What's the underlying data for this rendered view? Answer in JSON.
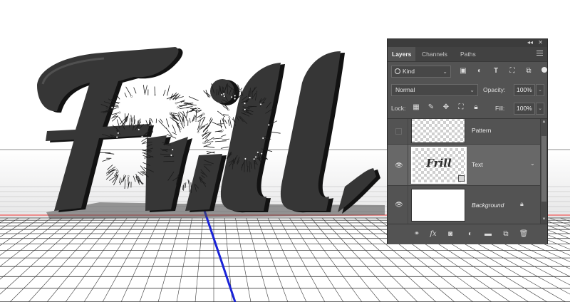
{
  "canvas": {
    "artwork_text": "Frill",
    "colors": {
      "background": "#ffffff",
      "grid_line": "#3b3b3b",
      "horizon_band": "#e9e9ea",
      "red_axis": "#ec8c8c",
      "blue_axis": "#1a23d8",
      "text_face": "#343434",
      "text_side": "#111111"
    }
  },
  "layers_panel": {
    "collapse_icon": "double-chevron-icon",
    "close_icon": "close-icon",
    "tabs": [
      {
        "label": "Layers",
        "active": true
      },
      {
        "label": "Channels",
        "active": false
      },
      {
        "label": "Paths",
        "active": false
      }
    ],
    "menu_icon": "panel-menu-icon",
    "filter": {
      "kind_label": "Kind",
      "icons": [
        "image-filter-icon",
        "adjustment-filter-icon",
        "type-filter-icon",
        "shape-filter-icon",
        "smart-object-filter-icon"
      ]
    },
    "blend_mode": "Normal",
    "opacity_label": "Opacity:",
    "opacity_value": "100%",
    "lock_label": "Lock:",
    "lock_icons": [
      "lock-transparent-icon",
      "lock-image-icon",
      "lock-position-icon",
      "lock-artboard-icon",
      "lock-all-icon"
    ],
    "fill_label": "Fill:",
    "fill_value": "100%",
    "layers": [
      {
        "name": "Pattern",
        "visible": false,
        "thumbnail": "transparent"
      },
      {
        "name": "Text",
        "visible": true,
        "selected": true,
        "thumbnail": "text",
        "thumb_text": "Frill",
        "smart_object": true
      },
      {
        "name": "Background",
        "visible": true,
        "locked": true,
        "thumbnail": "white"
      }
    ],
    "bottom_icons": [
      "link-icon",
      "fx-icon",
      "mask-icon",
      "adjustment-layer-icon",
      "folder-icon",
      "new-layer-icon",
      "trash-icon"
    ],
    "fx_label": "fx"
  }
}
